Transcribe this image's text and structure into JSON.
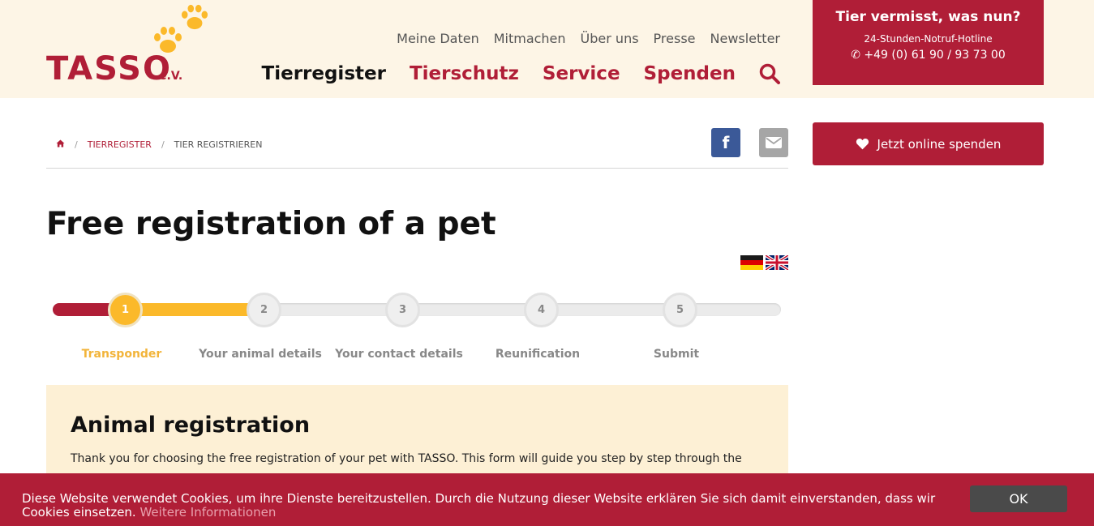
{
  "header": {
    "logo_text": "TASSO",
    "logo_suffix": "e.V.",
    "top_nav": [
      "Meine Daten",
      "Mitmachen",
      "Über uns",
      "Presse",
      "Newsletter"
    ],
    "main_nav": [
      "Tierregister",
      "Tierschutz",
      "Service",
      "Spenden"
    ],
    "search_icon": "search-icon"
  },
  "hotline": {
    "title": "Tier vermisst, was nun?",
    "subtitle": "24-Stunden-Notruf-Hotline",
    "phone": "+49 (0) 61 90 / 93 73 00"
  },
  "donate": {
    "label": "Jetzt online spenden",
    "icon": "heart-icon"
  },
  "breadcrumb": {
    "home_icon": "home-icon",
    "items": [
      "TIERREGISTER",
      "TIER REGISTRIEREN"
    ]
  },
  "share": {
    "facebook_label": "f",
    "mail_icon": "mail-icon"
  },
  "page": {
    "title": "Free registration of a pet"
  },
  "languages": [
    "de",
    "en"
  ],
  "steps": [
    {
      "number": "1",
      "label": "Transponder",
      "active": true
    },
    {
      "number": "2",
      "label": "Your animal details",
      "active": false
    },
    {
      "number": "3",
      "label": "Your contact details",
      "active": false
    },
    {
      "number": "4",
      "label": "Reunification",
      "active": false
    },
    {
      "number": "5",
      "label": "Submit",
      "active": false
    }
  ],
  "registration": {
    "title": "Animal registration",
    "text": "Thank you for choosing the free registration of your pet with TASSO. This form will guide you step by step through the"
  },
  "cookie": {
    "text": "Diese Website verwendet Cookies, um ihre Dienste bereitzustellen. Durch die Nutzung dieser Website erklären Sie sich damit einverstanden, dass wir Cookies einsetzen.",
    "link": "Weitere Informationen",
    "ok_label": "OK"
  },
  "colors": {
    "brand_red": "#b01e37",
    "accent_yellow": "#fbb92a",
    "header_bg": "#fdf5e6",
    "box_bg": "#fdf0d5"
  }
}
